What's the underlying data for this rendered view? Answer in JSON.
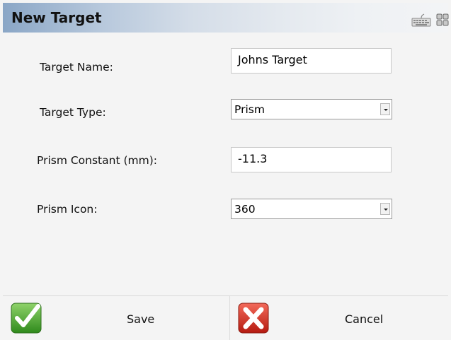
{
  "window": {
    "title": "New Target",
    "icons": [
      "keyboard-icon",
      "grid-icon"
    ]
  },
  "form": {
    "target_name_label": "Target Name:",
    "target_name_value": "Johns Target",
    "target_type_label": "Target Type:",
    "target_type_value": "Prism",
    "prism_constant_label": "Prism Constant (mm):",
    "prism_constant_value": "-11.3",
    "prism_icon_label": "Prism Icon:",
    "prism_icon_value": "360"
  },
  "buttons": {
    "save_label": "Save",
    "cancel_label": "Cancel"
  },
  "colors": {
    "title_gradient_start": "#8aa6c6",
    "save_icon": "#4aa42e",
    "cancel_icon": "#d62b1e"
  }
}
